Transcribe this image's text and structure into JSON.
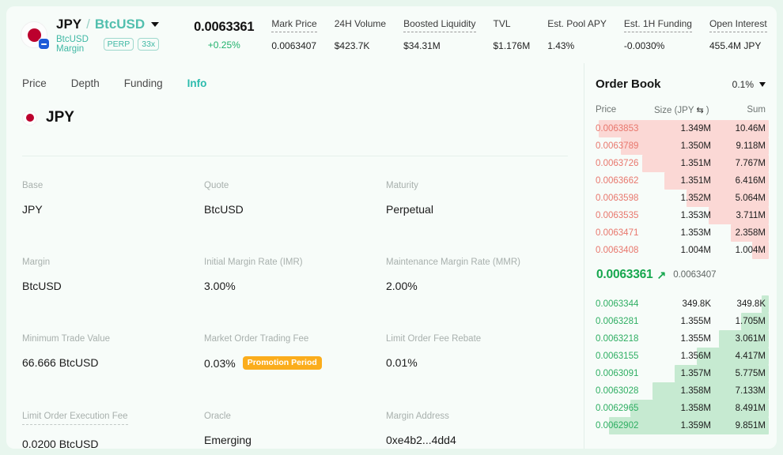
{
  "header": {
    "pair": {
      "base": "JPY",
      "slash": "/",
      "quote": "BtcUSD"
    },
    "margin_text": "BtcUSD Margin",
    "perp_tag": "PERP",
    "leverage_tag": "33x",
    "last_price": "0.0063361",
    "change_pct": "+0.25%",
    "stats": [
      {
        "label": "Mark Price",
        "value": "0.0063407",
        "dashed": true
      },
      {
        "label": "24H Volume",
        "value": "$423.7K",
        "dashed": false
      },
      {
        "label": "Boosted Liquidity",
        "value": "$34.31M",
        "dashed": true
      },
      {
        "label": "TVL",
        "value": "$1.176M",
        "dashed": false
      },
      {
        "label": "Est. Pool APY",
        "value": "1.43%",
        "dashed": false
      },
      {
        "label": "Est. 1H Funding",
        "value": "-0.0030%",
        "dashed": true
      },
      {
        "label": "Open Interest",
        "value": "455.4M JPY",
        "dashed": true
      }
    ]
  },
  "tabs": [
    {
      "label": "Price",
      "active": false
    },
    {
      "label": "Depth",
      "active": false
    },
    {
      "label": "Funding",
      "active": false
    },
    {
      "label": "Info",
      "active": true
    }
  ],
  "asset": {
    "name": "JPY"
  },
  "info": [
    {
      "label": "Base",
      "value": "JPY",
      "dashed": false,
      "badge": null,
      "link": false
    },
    {
      "label": "Quote",
      "value": "BtcUSD",
      "dashed": false,
      "badge": null,
      "link": false
    },
    {
      "label": "Maturity",
      "value": "Perpetual",
      "dashed": false,
      "badge": null,
      "link": false
    },
    {
      "label": "Margin",
      "value": "BtcUSD",
      "dashed": false,
      "badge": null,
      "link": false
    },
    {
      "label": "Initial Margin Rate (IMR)",
      "value": "3.00%",
      "dashed": false,
      "badge": null,
      "link": false
    },
    {
      "label": "Maintenance Margin Rate (MMR)",
      "value": "2.00%",
      "dashed": false,
      "badge": null,
      "link": false
    },
    {
      "label": "Minimum Trade Value",
      "value": "66.666 BtcUSD",
      "dashed": false,
      "badge": null,
      "link": false
    },
    {
      "label": "Market Order Trading Fee",
      "value": "0.03%",
      "dashed": false,
      "badge": "Promotion Period",
      "link": false
    },
    {
      "label": "Limit Order Fee Rebate",
      "value": "0.01%",
      "dashed": false,
      "badge": null,
      "link": false
    },
    {
      "label": "Limit Order Execution Fee",
      "value": "0.0200 BtcUSD",
      "dashed": true,
      "badge": null,
      "link": false
    },
    {
      "label": "Oracle",
      "value": "Emerging",
      "dashed": false,
      "badge": null,
      "link": false
    },
    {
      "label": "Margin Address",
      "value": "0xe4b2...4dd4",
      "dashed": false,
      "badge": null,
      "link": true
    }
  ],
  "order_book": {
    "title": "Order Book",
    "grouping": "0.1%",
    "columns": {
      "price": "Price",
      "size": "Size (JPY",
      "size_suffix": ")",
      "swap_icon": "⇆",
      "sum": "Sum"
    },
    "max_sum": 10.46,
    "asks": [
      {
        "price": "0.0063853",
        "size": "1.349M",
        "sum": "10.46M",
        "sum_val": 10.46
      },
      {
        "price": "0.0063789",
        "size": "1.350M",
        "sum": "9.118M",
        "sum_val": 9.118
      },
      {
        "price": "0.0063726",
        "size": "1.351M",
        "sum": "7.767M",
        "sum_val": 7.767
      },
      {
        "price": "0.0063662",
        "size": "1.351M",
        "sum": "6.416M",
        "sum_val": 6.416
      },
      {
        "price": "0.0063598",
        "size": "1.352M",
        "sum": "5.064M",
        "sum_val": 5.064
      },
      {
        "price": "0.0063535",
        "size": "1.353M",
        "sum": "3.711M",
        "sum_val": 3.711
      },
      {
        "price": "0.0063471",
        "size": "1.353M",
        "sum": "2.358M",
        "sum_val": 2.358
      },
      {
        "price": "0.0063408",
        "size": "1.004M",
        "sum": "1.004M",
        "sum_val": 1.004
      }
    ],
    "mid": {
      "price": "0.0063361",
      "arrow": "↗",
      "mark_price": "0.0063407"
    },
    "bids": [
      {
        "price": "0.0063344",
        "size": "349.8K",
        "sum": "349.8K",
        "sum_val": 0.3498
      },
      {
        "price": "0.0063281",
        "size": "1.355M",
        "sum": "1.705M",
        "sum_val": 1.705
      },
      {
        "price": "0.0063218",
        "size": "1.355M",
        "sum": "3.061M",
        "sum_val": 3.061
      },
      {
        "price": "0.0063155",
        "size": "1.356M",
        "sum": "4.417M",
        "sum_val": 4.417
      },
      {
        "price": "0.0063091",
        "size": "1.357M",
        "sum": "5.775M",
        "sum_val": 5.775
      },
      {
        "price": "0.0063028",
        "size": "1.358M",
        "sum": "7.133M",
        "sum_val": 7.133
      },
      {
        "price": "0.0062965",
        "size": "1.358M",
        "sum": "8.491M",
        "sum_val": 8.491
      },
      {
        "price": "0.0062902",
        "size": "1.359M",
        "sum": "9.851M",
        "sum_val": 9.851
      }
    ]
  },
  "colors": {
    "accent": "#2bbbad",
    "up": "#20b26c",
    "ask": "#e8776d",
    "bid": "#2eae62",
    "badge": "#fbad1c",
    "page_bg": "#e8f6ee",
    "panel_bg": "#f7fcf9"
  }
}
